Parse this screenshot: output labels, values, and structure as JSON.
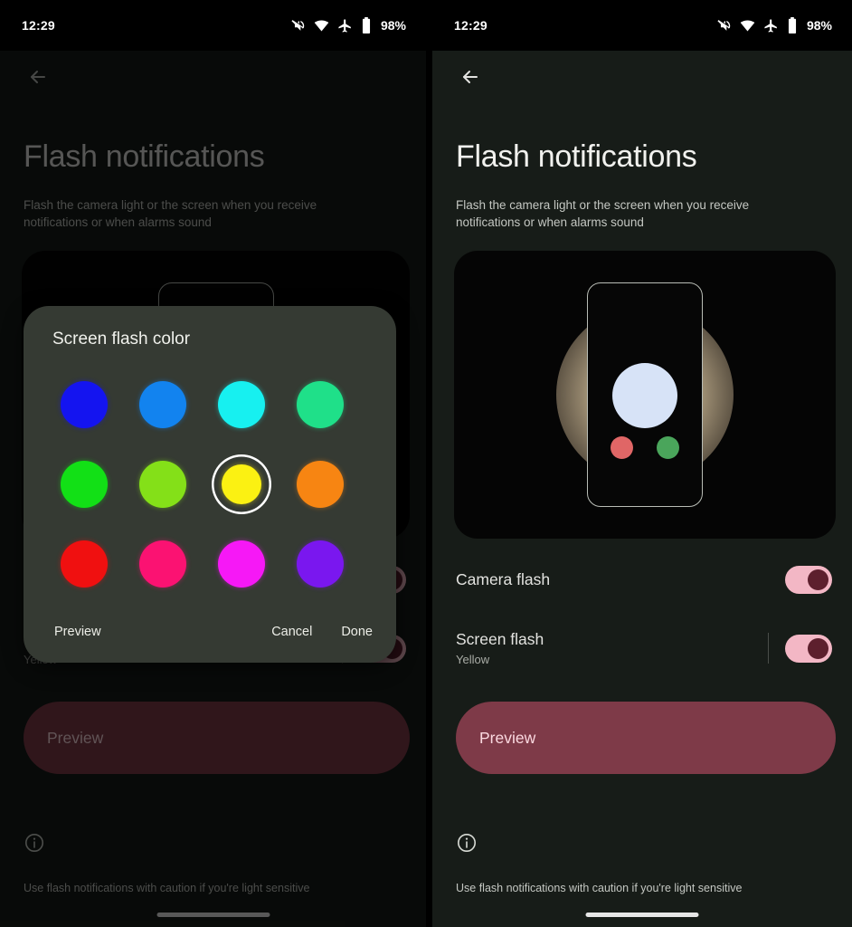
{
  "status_bar": {
    "time": "12:29",
    "battery": "98%",
    "icons": [
      "volume-off-icon",
      "wifi-icon",
      "airplane-mode-icon",
      "battery-icon"
    ]
  },
  "page": {
    "title": "Flash notifications",
    "description": "Flash the camera light or the screen when you receive notifications or when alarms sound",
    "back_label": "Back"
  },
  "rows": {
    "camera_flash": {
      "title": "Camera flash",
      "subtitle": "",
      "enabled": true
    },
    "screen_flash": {
      "title": "Screen flash",
      "subtitle": "Yellow",
      "enabled": true
    }
  },
  "preview_button": {
    "label": "Preview"
  },
  "footer": {
    "text": "Use flash notifications with caution if you're light sensitive",
    "icon": "info-icon"
  },
  "dialog": {
    "title": "Screen flash color",
    "buttons": {
      "preview": "Preview",
      "cancel": "Cancel",
      "done": "Done"
    },
    "selected_index": 6,
    "colors": [
      {
        "name": "Blue",
        "hex": "#1414f0"
      },
      {
        "name": "Azure",
        "hex": "#1283ef"
      },
      {
        "name": "Cyan",
        "hex": "#17f0f0"
      },
      {
        "name": "Spring green",
        "hex": "#1fe089"
      },
      {
        "name": "Green",
        "hex": "#12e016"
      },
      {
        "name": "Chartreuse",
        "hex": "#84e018"
      },
      {
        "name": "Yellow",
        "hex": "#fbf112"
      },
      {
        "name": "Orange",
        "hex": "#f78512"
      },
      {
        "name": "Red",
        "hex": "#f01010"
      },
      {
        "name": "Rose",
        "hex": "#fb1272"
      },
      {
        "name": "Magenta",
        "hex": "#f618f6"
      },
      {
        "name": "Violet",
        "hex": "#7a17ef"
      }
    ]
  },
  "theme": {
    "accent": "#f3b7c5",
    "preview_button_bg": "#7e3a48",
    "dialog_bg": "#353a33",
    "page_bg": "#171c18"
  }
}
